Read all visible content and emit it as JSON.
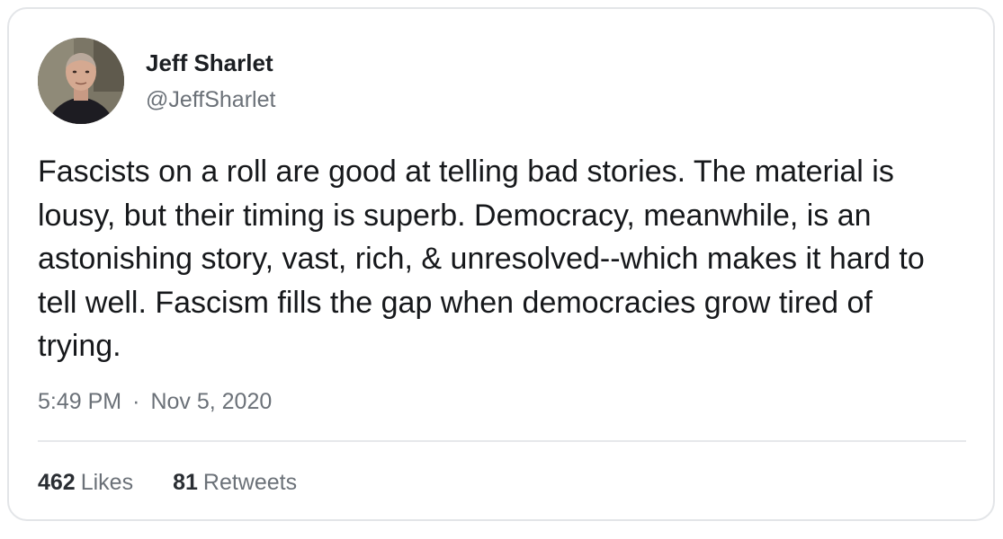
{
  "author": {
    "name": "Jeff Sharlet",
    "handle": "@JeffSharlet"
  },
  "tweet": {
    "text": "Fascists on a roll are good at telling bad stories. The material is lousy, but their timing is superb. Democracy, meanwhile, is an astonishing story, vast, rich, & unresolved--which makes it hard to tell well. Fascism fills the gap when democracies grow tired of trying.",
    "time": "5:49 PM",
    "separator": "·",
    "date": "Nov 5, 2020"
  },
  "stats": {
    "likes_count": "462",
    "likes_label": "Likes",
    "retweets_count": "81",
    "retweets_label": "Retweets"
  }
}
